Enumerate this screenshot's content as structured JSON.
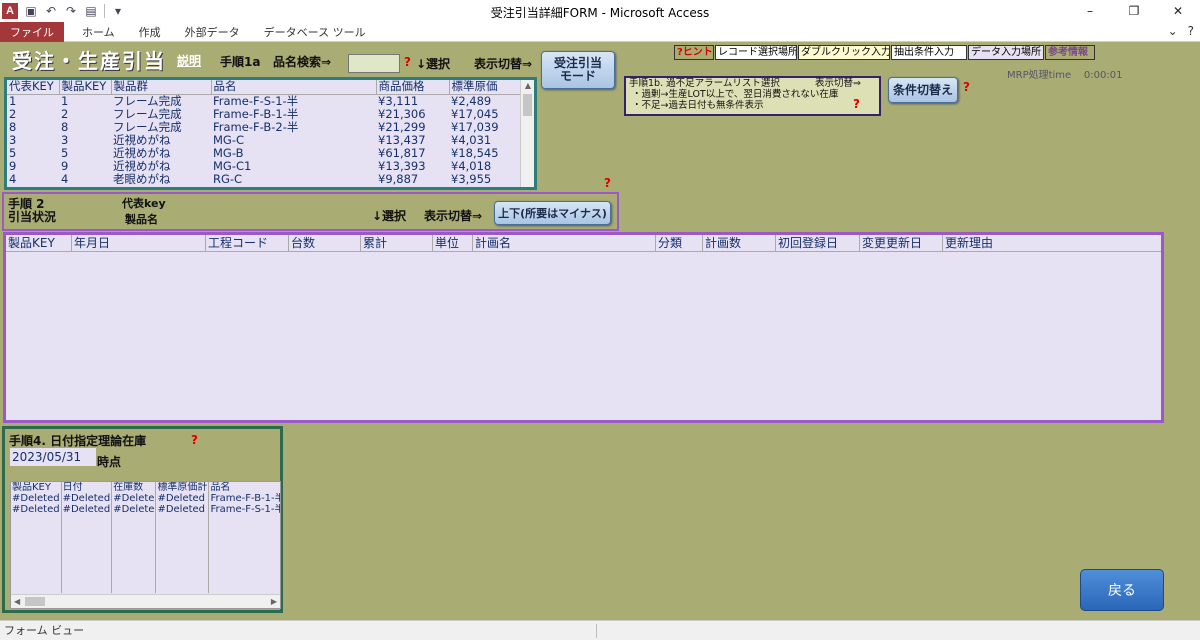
{
  "window": {
    "title": "受注引当詳細FORM  -  Microsoft Access",
    "app_logo": "A",
    "quick_access_icons": [
      "save-icon",
      "undo-icon",
      "redo-icon",
      "open-folder-icon",
      "customize-dropdown-icon"
    ],
    "controls": {
      "minimize": "–",
      "restore": "❐",
      "close": "✕"
    }
  },
  "ribbon": {
    "tabs": [
      "ファイル",
      "ホーム",
      "作成",
      "外部データ",
      "データベース ツール"
    ],
    "right_icons": {
      "collapse": "⌄",
      "help": "?"
    }
  },
  "form": {
    "title": "受注・生産引当",
    "help_link": "説明",
    "step1a": "手順1a",
    "product_search_label": "品名検索⇒",
    "search_value": "",
    "question_mark": "?",
    "select_down": "↓選択",
    "display_switch": "表示切替⇒",
    "order_alloc_button": [
      "受注引当",
      "モード"
    ],
    "top_strip": [
      "?ヒント",
      "レコード選択場所",
      "ダブルクリック入力支援",
      "抽出条件入力",
      "データ入力場所",
      "参考情報"
    ],
    "mrp_time_label": "MRP処理time",
    "mrp_time_value": "0:00:01",
    "alarm_box": {
      "line1": "手順1b. 過不足アラームリスト選択",
      "switch": "表示切替⇒",
      "line2": "・過剰→生産LOT以上で、翌日消費されない在庫",
      "line3": "・不足→過去日付も無条件表示"
    },
    "condition_switch_button": "条件切替え",
    "product_list": {
      "columns": [
        "代表KEY",
        "製品KEY",
        "製品群",
        "品名",
        "商品価格",
        "標準原価"
      ],
      "rows": [
        [
          "1",
          "1",
          "フレーム完成",
          "Frame-F-S-1-半",
          "¥3,111",
          "¥2,489"
        ],
        [
          "2",
          "2",
          "フレーム完成",
          "Frame-F-B-1-半",
          "¥21,306",
          "¥17,045"
        ],
        [
          "8",
          "8",
          "フレーム完成",
          "Frame-F-B-2-半",
          "¥21,299",
          "¥17,039"
        ],
        [
          "3",
          "3",
          "近視めがね",
          "MG-C",
          "¥13,437",
          "¥4,031"
        ],
        [
          "5",
          "5",
          "近視めがね",
          "MG-B",
          "¥61,817",
          "¥18,545"
        ],
        [
          "9",
          "9",
          "近視めがね",
          "MG-C1",
          "¥13,393",
          "¥4,018"
        ],
        [
          "4",
          "4",
          "老眼めがね",
          "RG-C",
          "¥9,887",
          "¥3,955"
        ]
      ]
    },
    "section2": {
      "step": "手順 2",
      "title": "引当状況",
      "rep_key_label": "代表key",
      "product_name_label": "製品名",
      "select_down": "↓選択",
      "display_switch": "表示切替⇒",
      "toggle_button": "上下(所要はマイナス)"
    },
    "grid2": {
      "columns": [
        "製品KEY",
        "年月日",
        "工程コード",
        "台数",
        "累計",
        "単位",
        "計画名",
        "分類",
        "計画数",
        "初回登録日",
        "変更更新日",
        "更新理由"
      ]
    },
    "section4": {
      "title": "手順4. 日付指定理論在庫",
      "date_value": "2023/05/31",
      "time_point_label": "時点",
      "columns": [
        "製品KEY",
        "日付",
        "在庫数",
        "標準原価計",
        "品名"
      ],
      "rows": [
        [
          "#Deleted",
          "#Deleted",
          "#Delete",
          "#Deleted",
          "Frame-F-B-1-半"
        ],
        [
          "#Deleted",
          "#Deleted",
          "#Delete",
          "#Deleted",
          "Frame-F-S-1-半"
        ]
      ]
    },
    "back_button": "戻る"
  },
  "statusbar": {
    "text": "フォーム ビュー"
  },
  "colors": {
    "form_bg": "#a9ac73",
    "list_bg": "#e6e1f3",
    "access_red": "#a4373a",
    "teal_border": "#2e7d7d",
    "purple_border": "#9b59c7",
    "back_button_blue": "#3a78c9"
  }
}
